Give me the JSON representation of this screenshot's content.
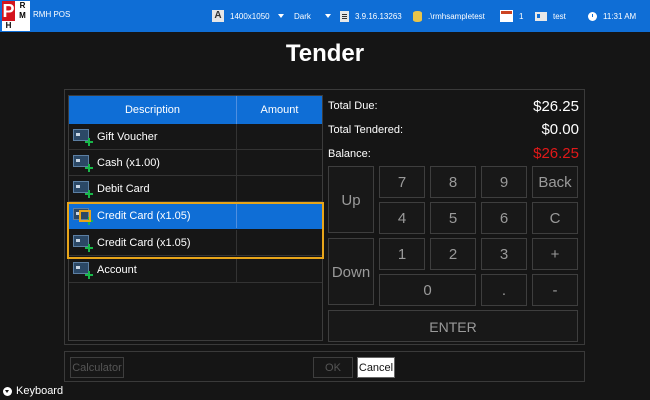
{
  "topbar": {
    "logo_p": "P",
    "logo_r": "R",
    "logo_m": "M",
    "logo_h": "H",
    "app_title": "RMH POS",
    "resolution_icon_glyph": "A",
    "resolution": "1400x1050",
    "theme": "Dark",
    "version": "3.9.16.13263",
    "database": ".\\rmhsampletest",
    "register": "1",
    "user": "test",
    "time": "11:31 AM",
    "colors": {
      "bar": "#0f6ed6",
      "logo_red": "#d4141e"
    }
  },
  "page_title": "Tender",
  "table": {
    "headers": {
      "description": "Description",
      "amount": "Amount"
    },
    "rows": [
      {
        "description": "Gift Voucher",
        "amount": ""
      },
      {
        "description": "Cash (x1.00)",
        "amount": ""
      },
      {
        "description": "Debit Card",
        "amount": ""
      },
      {
        "description": "Credit Card (x1.05)",
        "amount": "",
        "selected": true
      },
      {
        "description": "Credit Card (x1.05)",
        "amount": ""
      },
      {
        "description": "Account",
        "amount": ""
      }
    ],
    "row_icon": "card-add-icon",
    "highlight_color": "#e8a51a"
  },
  "totals": {
    "due_label": "Total Due:",
    "due_value": "$26.25",
    "tendered_label": "Total Tendered:",
    "tendered_value": "$0.00",
    "balance_label": "Balance:",
    "balance_value": "$26.25",
    "balance_color": "#e11919"
  },
  "keypad": {
    "up": "Up",
    "down": "Down",
    "k7": "7",
    "k8": "8",
    "k9": "9",
    "back": "Back",
    "k4": "4",
    "k5": "5",
    "k6": "6",
    "clear": "C",
    "k1": "1",
    "k2": "2",
    "k3": "3",
    "plus": "+",
    "k0": "0",
    "dot": ".",
    "minus": "-",
    "enter": "ENTER"
  },
  "buttons": {
    "calculator": "Calculator",
    "ok": "OK",
    "cancel": "Cancel"
  },
  "keyboard_toggle": "Keyboard"
}
